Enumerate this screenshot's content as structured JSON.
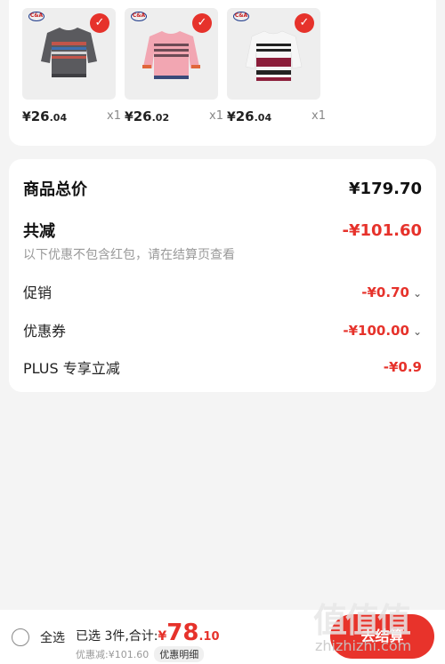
{
  "products": [
    {
      "price_int": "26",
      "price_dec": ".04",
      "qty": "x1",
      "brand": "C&A"
    },
    {
      "price_int": "26",
      "price_dec": ".02",
      "qty": "x1",
      "brand": "C&A"
    },
    {
      "price_int": "26",
      "price_dec": ".04",
      "qty": "x1",
      "brand": "C&A"
    }
  ],
  "currency": "¥",
  "summary": {
    "total_label": "商品总价",
    "total_value": "¥179.70",
    "reduce_label": "共减",
    "reduce_value": "-¥101.60",
    "note": "以下优惠不包含红包，请在结算页查看",
    "promo_label": "促销",
    "promo_value": "-¥0.70",
    "coupon_label": "优惠券",
    "coupon_value": "-¥100.00",
    "plus_label": "PLUS 专享立减",
    "plus_value": "-¥0.9"
  },
  "bottom": {
    "select_all": "全选",
    "selected_text": "已选 3件,合计:",
    "total_int": "78",
    "total_dec": ".10",
    "discount_text": "优惠减:¥101.60",
    "detail_button": "优惠明细",
    "checkout_button": "去结算"
  },
  "watermark": {
    "chars": "值值值",
    "url": "zhizhizhi.com"
  },
  "colors": {
    "accent": "#e6322b",
    "background": "#f4f4f4"
  }
}
